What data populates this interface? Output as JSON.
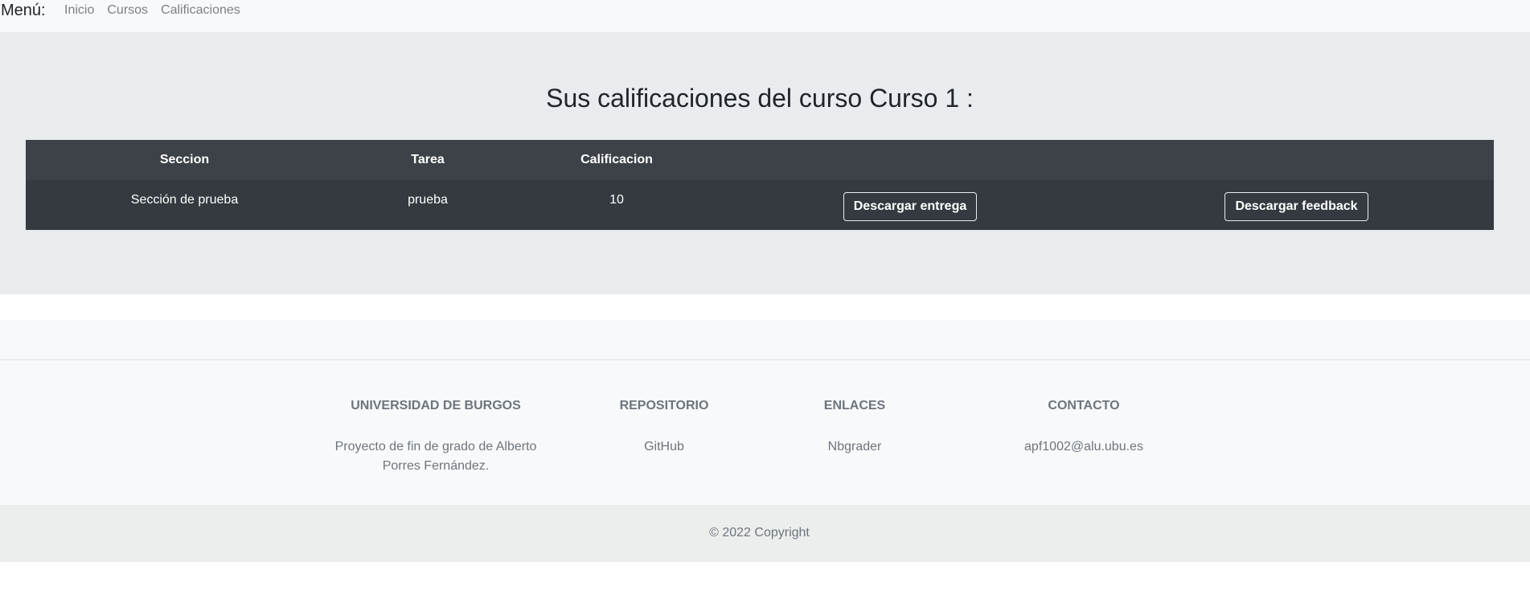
{
  "nav": {
    "brand": "Menú:",
    "links": [
      "Inicio",
      "Cursos",
      "Calificaciones"
    ]
  },
  "page": {
    "title": "Sus calificaciones del curso Curso 1 :"
  },
  "table": {
    "headers": [
      "Seccion",
      "Tarea",
      "Calificacion"
    ],
    "rows": [
      {
        "seccion": "Sección de prueba",
        "tarea": "prueba",
        "calificacion": "10",
        "download_submission": "Descargar entrega",
        "download_feedback": "Descargar feedback"
      }
    ]
  },
  "footer": {
    "columns": [
      {
        "heading": "UNIVERSIDAD DE BURGOS",
        "text": "Proyecto de fin de grado de Alberto Porres Fernández."
      },
      {
        "heading": "REPOSITORIO",
        "link": "GitHub"
      },
      {
        "heading": "ENLACES",
        "link": "Nbgrader"
      },
      {
        "heading": "CONTACTO",
        "text": "apf1002@alu.ubu.es"
      }
    ],
    "copyright": "© 2022 Copyright"
  }
}
